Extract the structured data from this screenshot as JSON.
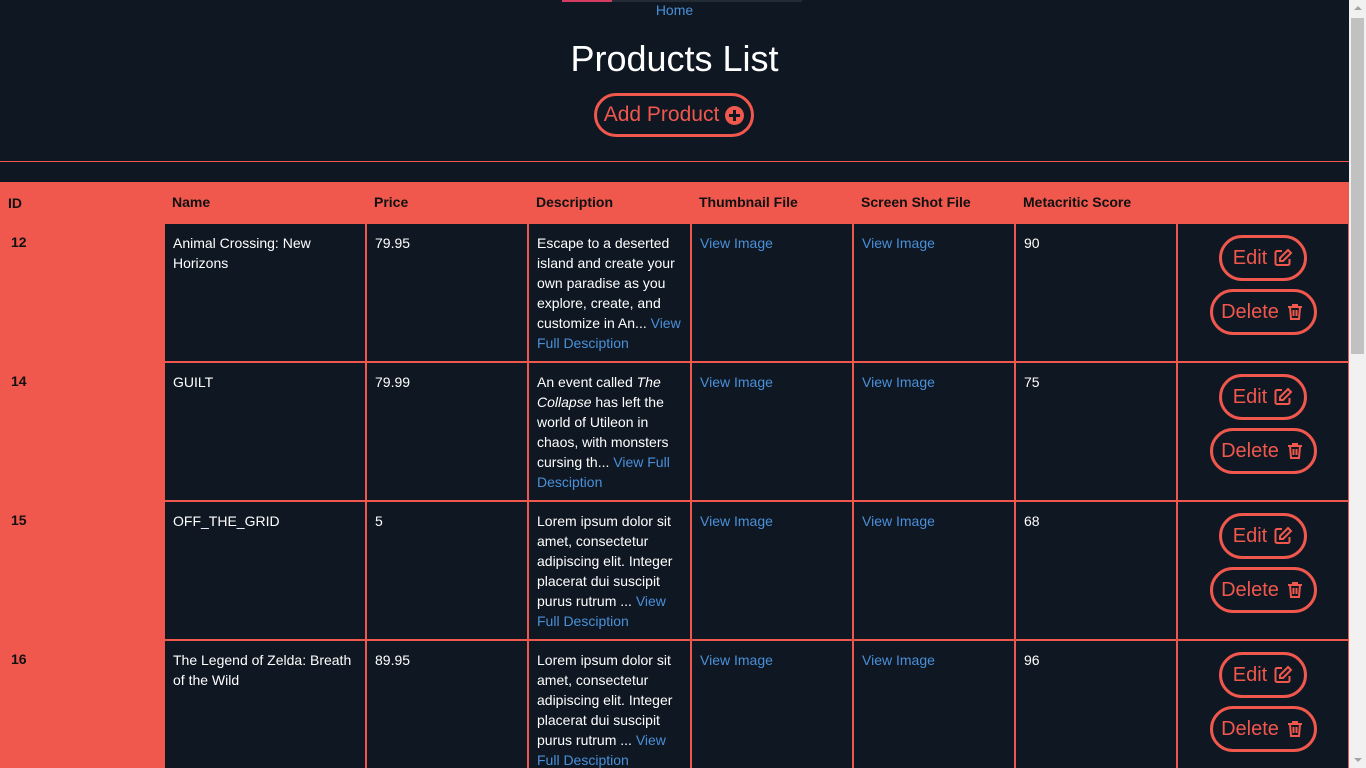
{
  "nav": {
    "home_label": "Home"
  },
  "header": {
    "title": "Products List",
    "add_label": "Add Product"
  },
  "colors": {
    "accent": "#f0574d",
    "background": "#0f1722",
    "link": "#4a90d9"
  },
  "table": {
    "columns": [
      "ID",
      "Name",
      "Price",
      "Description",
      "Thumbnail File",
      "Screen Shot File",
      "Metacritic Score",
      ""
    ],
    "rows": [
      {
        "id": "12",
        "name": "Animal Crossing: New Horizons",
        "price": "79.95",
        "description": "Escape to a deserted island and create your own paradise as you explore, create, and customize in An...",
        "desc_link": "View Full Desciption",
        "thumbnail": "View Image",
        "screenshot": "View Image",
        "score": "90",
        "edit_label": "Edit",
        "delete_label": "Delete"
      },
      {
        "id": "14",
        "name": "GUILT",
        "price": "79.99",
        "description_pre": "An event called ",
        "description_em": "The Collapse",
        "description_post": " has left the world of Utileon in chaos, with monsters cursing th...",
        "desc_link": "View Full Desciption",
        "thumbnail": "View Image",
        "screenshot": "View Image",
        "score": "75",
        "edit_label": "Edit",
        "delete_label": "Delete"
      },
      {
        "id": "15",
        "name": "OFF_THE_GRID",
        "price": "5",
        "description": "Lorem ipsum dolor sit amet, consectetur adipiscing elit. Integer placerat dui suscipit purus rutrum ...",
        "desc_link": "View Full Desciption",
        "thumbnail": "View Image",
        "screenshot": "View Image",
        "score": "68",
        "edit_label": "Edit",
        "delete_label": "Delete"
      },
      {
        "id": "16",
        "name": "The Legend of Zelda: Breath of the Wild",
        "price": "89.95",
        "description": "Lorem ipsum dolor sit amet, consectetur adipiscing elit. Integer placerat dui suscipit purus rutrum ...",
        "desc_link": "View Full Desciption",
        "thumbnail": "View Image",
        "screenshot": "View Image",
        "score": "96",
        "edit_label": "Edit",
        "delete_label": "Delete"
      }
    ]
  },
  "icons": {
    "add": "plus-circle-icon",
    "edit": "edit-icon",
    "delete": "trash-icon"
  }
}
